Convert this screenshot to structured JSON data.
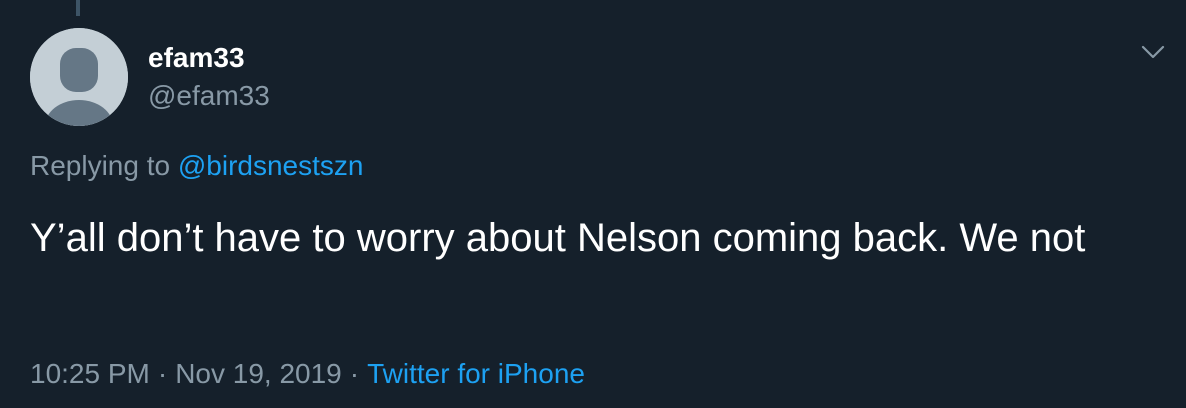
{
  "tweet": {
    "author": {
      "display_name": "efam33",
      "handle": "@efam33",
      "avatar_icon": "default-profile-silhouette-icon"
    },
    "menu_icon": "chevron-down-icon",
    "replying_to": {
      "prefix": "Replying to",
      "handle": "@birdsnestszn"
    },
    "text": "Y’all don’t have to worry about Nelson coming back. We not",
    "time": "10:25 PM",
    "separator": "·",
    "date": "Nov 19, 2019",
    "source": "Twitter for iPhone"
  },
  "colors": {
    "background": "#15202b",
    "text": "#ffffff",
    "muted": "#8899a6",
    "link": "#1da1f2",
    "thread_line": "#3d5466",
    "avatar_bg": "#c4cfd6",
    "avatar_fg": "#657786"
  }
}
